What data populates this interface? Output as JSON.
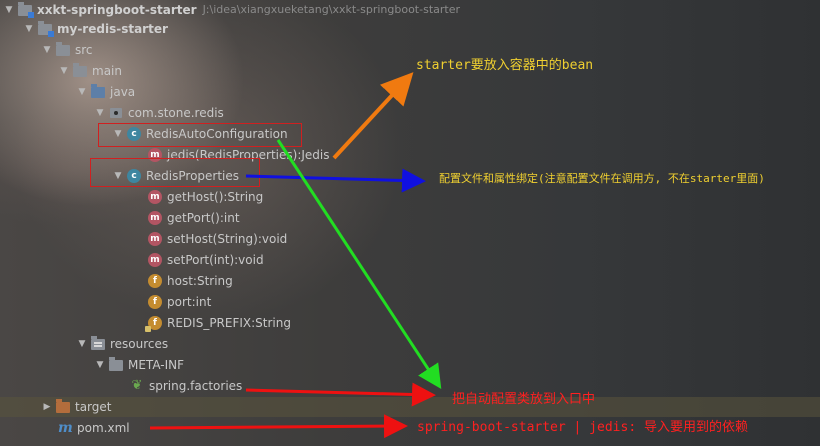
{
  "project": {
    "name": "xxkt-springboot-starter",
    "path": "J:\\idea\\xiangxueketang\\xxkt-springboot-starter"
  },
  "tree": {
    "module": "my-redis-starter",
    "src": "src",
    "main": "main",
    "java": "java",
    "package": "com.stone.redis",
    "class_auto_config": "RedisAutoConfiguration",
    "auto_config_method": "jedis(RedisProperties):Jedis",
    "class_properties": "RedisProperties",
    "members": [
      {
        "kind": "m",
        "label": "getHost():String"
      },
      {
        "kind": "m",
        "label": "getPort():int"
      },
      {
        "kind": "m",
        "label": "setHost(String):void"
      },
      {
        "kind": "m",
        "label": "setPort(int):void"
      },
      {
        "kind": "f",
        "label": "host:String"
      },
      {
        "kind": "f",
        "label": "port:int"
      },
      {
        "kind": "f",
        "label": "REDIS_PREFIX:String"
      }
    ],
    "resources": "resources",
    "meta_inf": "META-INF",
    "spring_factories": "spring.factories",
    "target": "target",
    "pom": "pom.xml"
  },
  "icons": {
    "expand": "triangle-down-icon",
    "collapse": "triangle-right-icon",
    "class": "class-icon",
    "method": "method-icon",
    "field": "field-icon",
    "maven": "maven-icon"
  },
  "annotations": {
    "bean": "starter要放入容器中的bean",
    "properties": "配置文件和属性绑定(注意配置文件在调用方, 不在starter里面)",
    "factories": "把自动配置类放到入口中",
    "pom": "spring-boot-starter | jedis: 导入要用到的依赖"
  },
  "colors": {
    "orange_arrow": "#f07a10",
    "blue_arrow": "#1010e0",
    "green_arrow": "#22dd22",
    "red_arrow": "#ee1111",
    "anno_yellow": "#f0d030",
    "anno_red": "#ff2020"
  }
}
